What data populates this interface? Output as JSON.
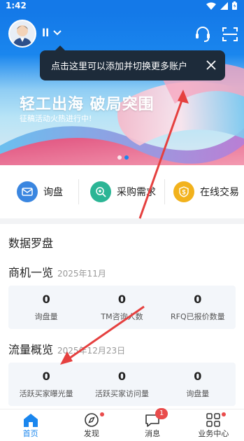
{
  "status": {
    "time": "1:42"
  },
  "header": {
    "account_name": "ll"
  },
  "banner": {
    "title": "轻工出海 破局突围",
    "subtitle": "征稿活动火热进行中!"
  },
  "tooltip": {
    "text": "点击这里可以添加并切换更多账户"
  },
  "quick_actions": [
    {
      "label": "询盘",
      "color": "#3a86e0"
    },
    {
      "label": "采购需求",
      "color": "#2bb595"
    },
    {
      "label": "在线交易",
      "color": "#f2b21c"
    }
  ],
  "data_compass": {
    "title": "数据罗盘"
  },
  "business": {
    "title": "商机一览",
    "date": "2025年11月",
    "stats": [
      {
        "value": "0",
        "label": "询盘量"
      },
      {
        "value": "0",
        "label": "TM咨询人数"
      },
      {
        "value": "0",
        "label": "RFQ已报价数量"
      }
    ]
  },
  "traffic": {
    "title": "流量概览",
    "date": "2025年12月23日",
    "stats": [
      {
        "value": "0",
        "label": "活跃买家曝光量"
      },
      {
        "value": "0",
        "label": "活跃买家访问量"
      },
      {
        "value": "0",
        "label": "询盘量"
      }
    ]
  },
  "tabbar": [
    {
      "label": "首页",
      "active": true
    },
    {
      "label": "发现"
    },
    {
      "label": "消息",
      "badge": "1"
    },
    {
      "label": "业务中心"
    }
  ],
  "colors": {
    "primary": "#1479e8",
    "badge": "#e94b4b",
    "arrow": "#e5403f"
  }
}
